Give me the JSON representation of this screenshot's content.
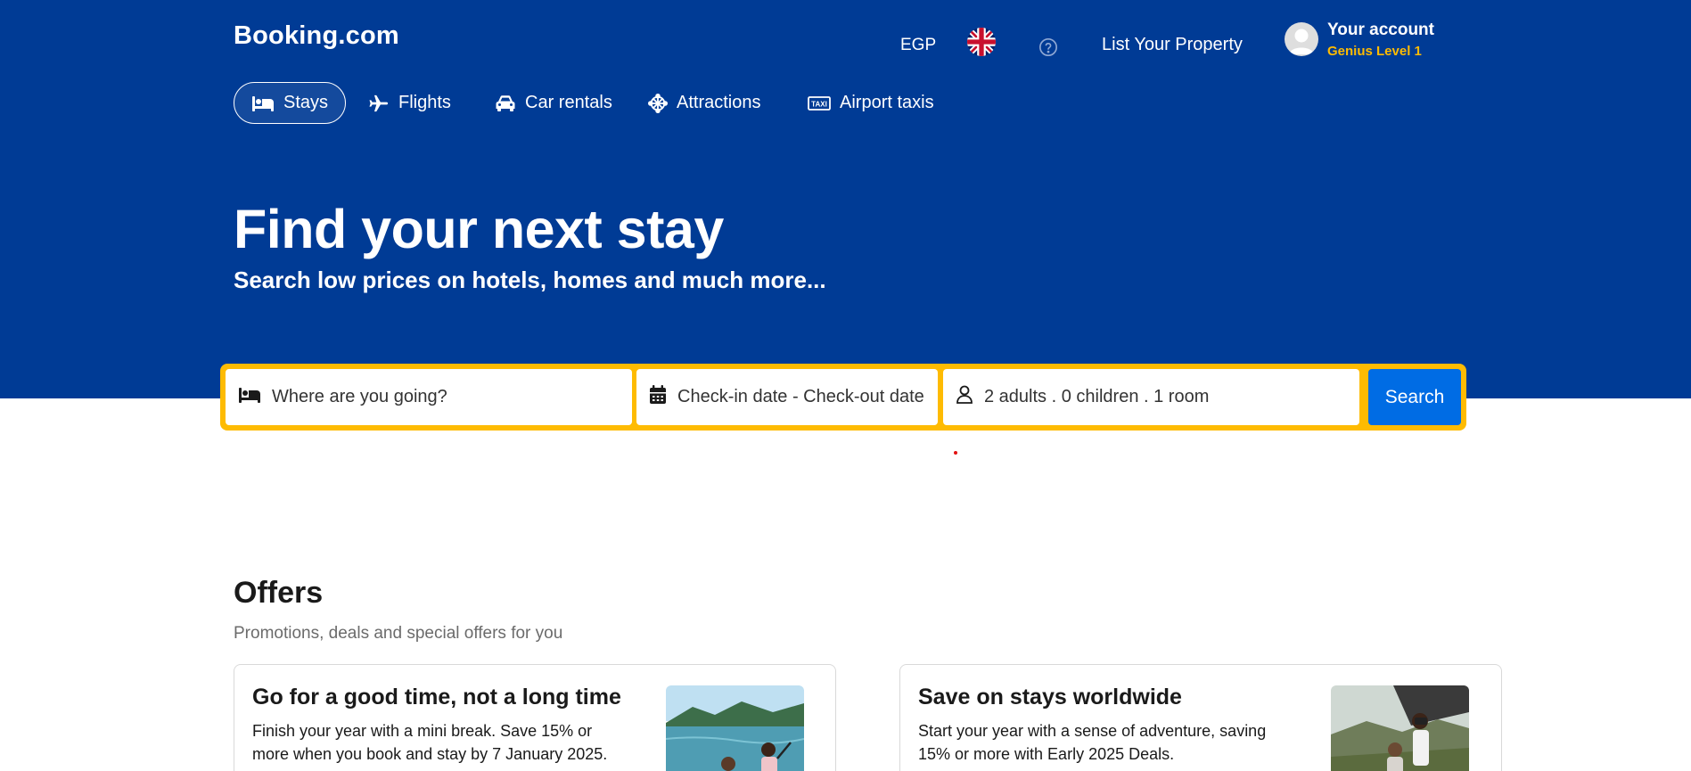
{
  "brand": {
    "name": "Booking.com"
  },
  "header": {
    "currency": "EGP",
    "language_icon": "uk-flag-icon",
    "help_icon": "question-circle-icon",
    "list_property": "List Your Property",
    "account_name": "Your account",
    "account_level": "Genius Level 1"
  },
  "categories": [
    {
      "label": "Stays",
      "icon": "bed-icon",
      "active": true
    },
    {
      "label": "Flights",
      "icon": "plane-icon",
      "active": false
    },
    {
      "label": "Car rentals",
      "icon": "car-icon",
      "active": false
    },
    {
      "label": "Attractions",
      "icon": "ferris-wheel-icon",
      "active": false
    },
    {
      "label": "Airport taxis",
      "icon": "taxi-icon",
      "active": false
    }
  ],
  "hero": {
    "headline": "Find your next stay",
    "subheadline": "Search low prices on hotels, homes and much more..."
  },
  "search": {
    "destination_placeholder": "Where are you going?",
    "dates_placeholder": "Check-in date - Check-out date",
    "occupancy": "2 adults . 0 children . 1 room",
    "button_label": "Search"
  },
  "offers": {
    "title": "Offers",
    "subtitle": "Promotions, deals and special offers for you",
    "cards": [
      {
        "title": "Go for a good time, not a long time",
        "description": "Finish your year with a mini break. Save 15% or more when you book and stay by 7 January 2025."
      },
      {
        "title": "Save on stays worldwide",
        "description": "Start your year with a sense of adventure, saving 15% or more with Early 2025 Deals."
      }
    ]
  },
  "colors": {
    "brand_blue": "#003b95",
    "search_border": "#febb02",
    "search_button": "#006ce4",
    "genius_yellow": "#febb02"
  }
}
